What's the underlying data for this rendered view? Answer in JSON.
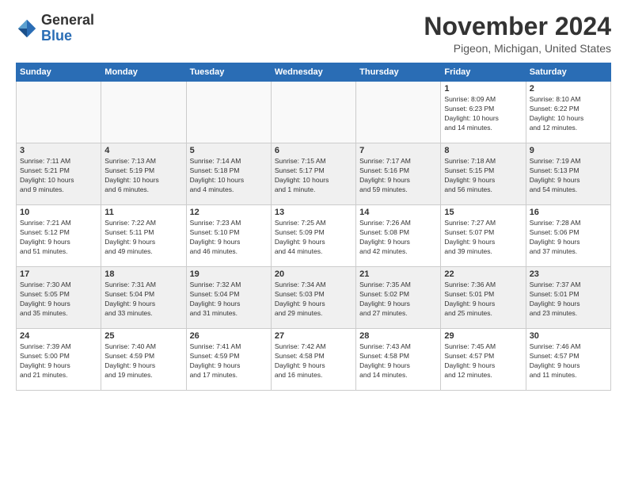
{
  "header": {
    "logo_line1": "General",
    "logo_line2": "Blue",
    "month": "November 2024",
    "location": "Pigeon, Michigan, United States"
  },
  "weekdays": [
    "Sunday",
    "Monday",
    "Tuesday",
    "Wednesday",
    "Thursday",
    "Friday",
    "Saturday"
  ],
  "weeks": [
    [
      {
        "day": "",
        "info": ""
      },
      {
        "day": "",
        "info": ""
      },
      {
        "day": "",
        "info": ""
      },
      {
        "day": "",
        "info": ""
      },
      {
        "day": "",
        "info": ""
      },
      {
        "day": "1",
        "info": "Sunrise: 8:09 AM\nSunset: 6:23 PM\nDaylight: 10 hours\nand 14 minutes."
      },
      {
        "day": "2",
        "info": "Sunrise: 8:10 AM\nSunset: 6:22 PM\nDaylight: 10 hours\nand 12 minutes."
      }
    ],
    [
      {
        "day": "3",
        "info": "Sunrise: 7:11 AM\nSunset: 5:21 PM\nDaylight: 10 hours\nand 9 minutes."
      },
      {
        "day": "4",
        "info": "Sunrise: 7:13 AM\nSunset: 5:19 PM\nDaylight: 10 hours\nand 6 minutes."
      },
      {
        "day": "5",
        "info": "Sunrise: 7:14 AM\nSunset: 5:18 PM\nDaylight: 10 hours\nand 4 minutes."
      },
      {
        "day": "6",
        "info": "Sunrise: 7:15 AM\nSunset: 5:17 PM\nDaylight: 10 hours\nand 1 minute."
      },
      {
        "day": "7",
        "info": "Sunrise: 7:17 AM\nSunset: 5:16 PM\nDaylight: 9 hours\nand 59 minutes."
      },
      {
        "day": "8",
        "info": "Sunrise: 7:18 AM\nSunset: 5:15 PM\nDaylight: 9 hours\nand 56 minutes."
      },
      {
        "day": "9",
        "info": "Sunrise: 7:19 AM\nSunset: 5:13 PM\nDaylight: 9 hours\nand 54 minutes."
      }
    ],
    [
      {
        "day": "10",
        "info": "Sunrise: 7:21 AM\nSunset: 5:12 PM\nDaylight: 9 hours\nand 51 minutes."
      },
      {
        "day": "11",
        "info": "Sunrise: 7:22 AM\nSunset: 5:11 PM\nDaylight: 9 hours\nand 49 minutes."
      },
      {
        "day": "12",
        "info": "Sunrise: 7:23 AM\nSunset: 5:10 PM\nDaylight: 9 hours\nand 46 minutes."
      },
      {
        "day": "13",
        "info": "Sunrise: 7:25 AM\nSunset: 5:09 PM\nDaylight: 9 hours\nand 44 minutes."
      },
      {
        "day": "14",
        "info": "Sunrise: 7:26 AM\nSunset: 5:08 PM\nDaylight: 9 hours\nand 42 minutes."
      },
      {
        "day": "15",
        "info": "Sunrise: 7:27 AM\nSunset: 5:07 PM\nDaylight: 9 hours\nand 39 minutes."
      },
      {
        "day": "16",
        "info": "Sunrise: 7:28 AM\nSunset: 5:06 PM\nDaylight: 9 hours\nand 37 minutes."
      }
    ],
    [
      {
        "day": "17",
        "info": "Sunrise: 7:30 AM\nSunset: 5:05 PM\nDaylight: 9 hours\nand 35 minutes."
      },
      {
        "day": "18",
        "info": "Sunrise: 7:31 AM\nSunset: 5:04 PM\nDaylight: 9 hours\nand 33 minutes."
      },
      {
        "day": "19",
        "info": "Sunrise: 7:32 AM\nSunset: 5:04 PM\nDaylight: 9 hours\nand 31 minutes."
      },
      {
        "day": "20",
        "info": "Sunrise: 7:34 AM\nSunset: 5:03 PM\nDaylight: 9 hours\nand 29 minutes."
      },
      {
        "day": "21",
        "info": "Sunrise: 7:35 AM\nSunset: 5:02 PM\nDaylight: 9 hours\nand 27 minutes."
      },
      {
        "day": "22",
        "info": "Sunrise: 7:36 AM\nSunset: 5:01 PM\nDaylight: 9 hours\nand 25 minutes."
      },
      {
        "day": "23",
        "info": "Sunrise: 7:37 AM\nSunset: 5:01 PM\nDaylight: 9 hours\nand 23 minutes."
      }
    ],
    [
      {
        "day": "24",
        "info": "Sunrise: 7:39 AM\nSunset: 5:00 PM\nDaylight: 9 hours\nand 21 minutes."
      },
      {
        "day": "25",
        "info": "Sunrise: 7:40 AM\nSunset: 4:59 PM\nDaylight: 9 hours\nand 19 minutes."
      },
      {
        "day": "26",
        "info": "Sunrise: 7:41 AM\nSunset: 4:59 PM\nDaylight: 9 hours\nand 17 minutes."
      },
      {
        "day": "27",
        "info": "Sunrise: 7:42 AM\nSunset: 4:58 PM\nDaylight: 9 hours\nand 16 minutes."
      },
      {
        "day": "28",
        "info": "Sunrise: 7:43 AM\nSunset: 4:58 PM\nDaylight: 9 hours\nand 14 minutes."
      },
      {
        "day": "29",
        "info": "Sunrise: 7:45 AM\nSunset: 4:57 PM\nDaylight: 9 hours\nand 12 minutes."
      },
      {
        "day": "30",
        "info": "Sunrise: 7:46 AM\nSunset: 4:57 PM\nDaylight: 9 hours\nand 11 minutes."
      }
    ]
  ]
}
